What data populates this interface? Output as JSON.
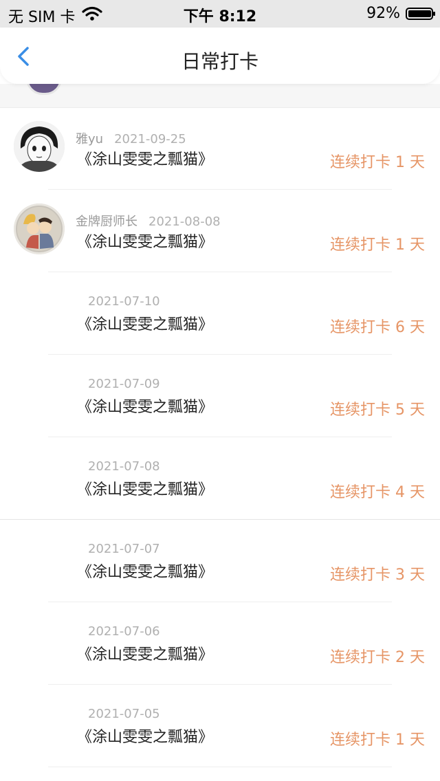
{
  "status_bar": {
    "carrier": "无 SIM 卡",
    "time": "下午 8:12",
    "battery_percent": "92%",
    "battery_level": 0.92
  },
  "nav": {
    "title": "日常打卡",
    "back_icon": "chevron-left-icon",
    "accent_color": "#3a8ee6"
  },
  "colors": {
    "streak": "#e69566",
    "date": "#b0b0b0"
  },
  "records": [
    {
      "user": "雅yu",
      "date": "2021-09-25",
      "book": "《涂山雯雯之瓢猫》",
      "streak": "连续打卡 1 天",
      "avatar": "manga-portrait"
    },
    {
      "user": "金牌厨师长",
      "date": "2021-08-08",
      "book": "《涂山雯雯之瓢猫》",
      "streak": "连续打卡 1 天",
      "avatar": "cartoon-couple"
    },
    {
      "user": "",
      "date": "2021-07-10",
      "book": "《涂山雯雯之瓢猫》",
      "streak": "连续打卡 6 天"
    },
    {
      "user": "",
      "date": "2021-07-09",
      "book": "《涂山雯雯之瓢猫》",
      "streak": "连续打卡 5 天"
    },
    {
      "user": "",
      "date": "2021-07-08",
      "book": "《涂山雯雯之瓢猫》",
      "streak": "连续打卡 4 天"
    },
    {
      "user": "",
      "date": "2021-07-07",
      "book": "《涂山雯雯之瓢猫》",
      "streak": "连续打卡 3 天"
    },
    {
      "user": "",
      "date": "2021-07-06",
      "book": "《涂山雯雯之瓢猫》",
      "streak": "连续打卡 2 天"
    },
    {
      "user": "",
      "date": "2021-07-05",
      "book": "《涂山雯雯之瓢猫》",
      "streak": "连续打卡 1 天"
    }
  ]
}
